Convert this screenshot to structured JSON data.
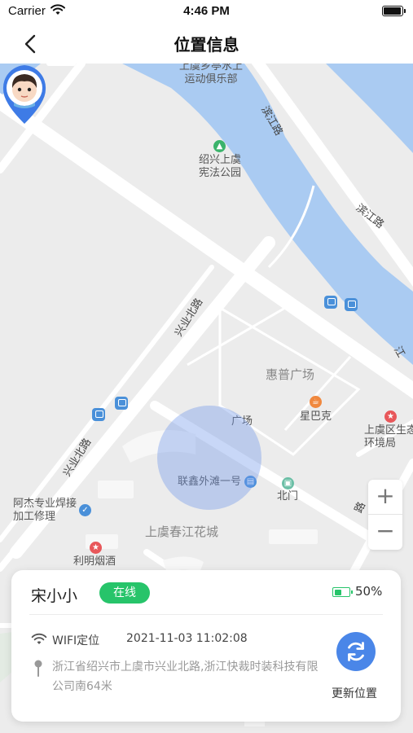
{
  "status_bar": {
    "carrier": "Carrier",
    "time": "4:46 PM",
    "battery_level": 1.0
  },
  "nav": {
    "title": "位置信息",
    "back_icon": "chevron-left-icon"
  },
  "map": {
    "labels": {
      "club": "上虞乡亭水上\n运动俱乐部",
      "park": "绍兴上虞\n宪法公园",
      "binjiang_road_1": "滨江路",
      "binjiang_road_2": "滨江路",
      "jiang_edge": "江",
      "xingye_north_1": "兴业北路",
      "xingye_north_2": "兴业北路",
      "huipu_square": "惠普广场",
      "starbucks": "星巴克",
      "env_bureau": "上虞区生态\n环境局",
      "square_partial": "广场",
      "lianxin": "联鑫外滩一号",
      "north_gate": "北门",
      "welding": "阿杰专业焊接\n加工修理",
      "chunjiang": "上虞春江花城",
      "liming": "利明烟酒",
      "road_partial": "路"
    },
    "colors": {
      "water": "#aacbf2",
      "land": "#ececec",
      "road": "#ffffff",
      "halo": "#6e96eb",
      "pin": "#3e7be6"
    },
    "zoom_in": "+",
    "zoom_out": "−"
  },
  "device": {
    "name": "宋小小",
    "status": "在线",
    "battery_percent": "50%",
    "battery_level": 0.5,
    "locate_method": "WIFI定位",
    "locate_time": "2021-11-03 11:02:08",
    "address": "浙江省绍兴市上虞市兴业北路,浙江快裁时装科技有限公司南64米",
    "refresh_label": "更新位置",
    "accent_color": "#27c46a",
    "button_color": "#4a86e8"
  }
}
